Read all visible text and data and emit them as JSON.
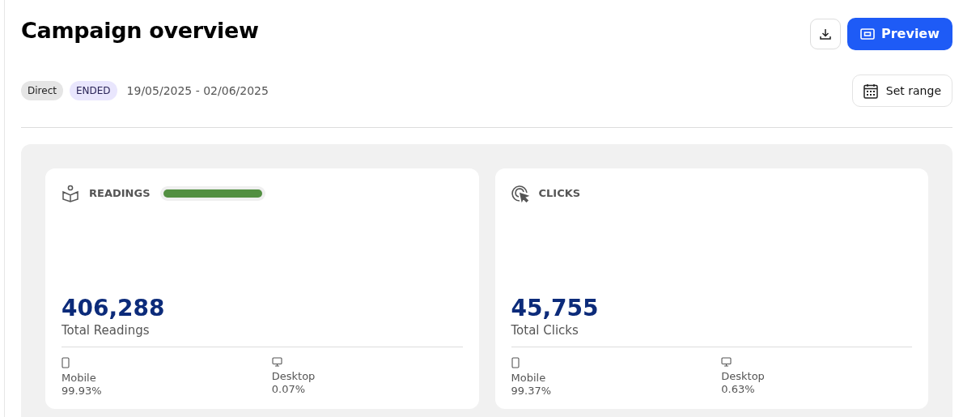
{
  "header": {
    "title": "Campaign overview",
    "preview_button": "Preview"
  },
  "tags": [
    {
      "label": "Direct",
      "kind": "type"
    },
    {
      "label": "ENDED",
      "kind": "status"
    }
  ],
  "date_range": "19/05/2025 - 02/06/2025",
  "set_range_button": "Set range",
  "metrics": [
    {
      "kind": "readings",
      "title": "READINGS",
      "progress": {
        "level": 1.0
      },
      "value": "406,288",
      "caption": "Total Readings",
      "devices": [
        {
          "kind": "mobile",
          "label": "Mobile",
          "share": "99.93%"
        },
        {
          "kind": "desktop",
          "label": "Desktop",
          "share": "0.07%"
        }
      ]
    },
    {
      "kind": "clicks",
      "title": "CLICKS",
      "value": "45,755",
      "caption": "Total Clicks",
      "devices": [
        {
          "kind": "mobile",
          "label": "Mobile",
          "share": "99.37%"
        },
        {
          "kind": "desktop",
          "label": "Desktop",
          "share": "0.63%"
        }
      ]
    }
  ]
}
